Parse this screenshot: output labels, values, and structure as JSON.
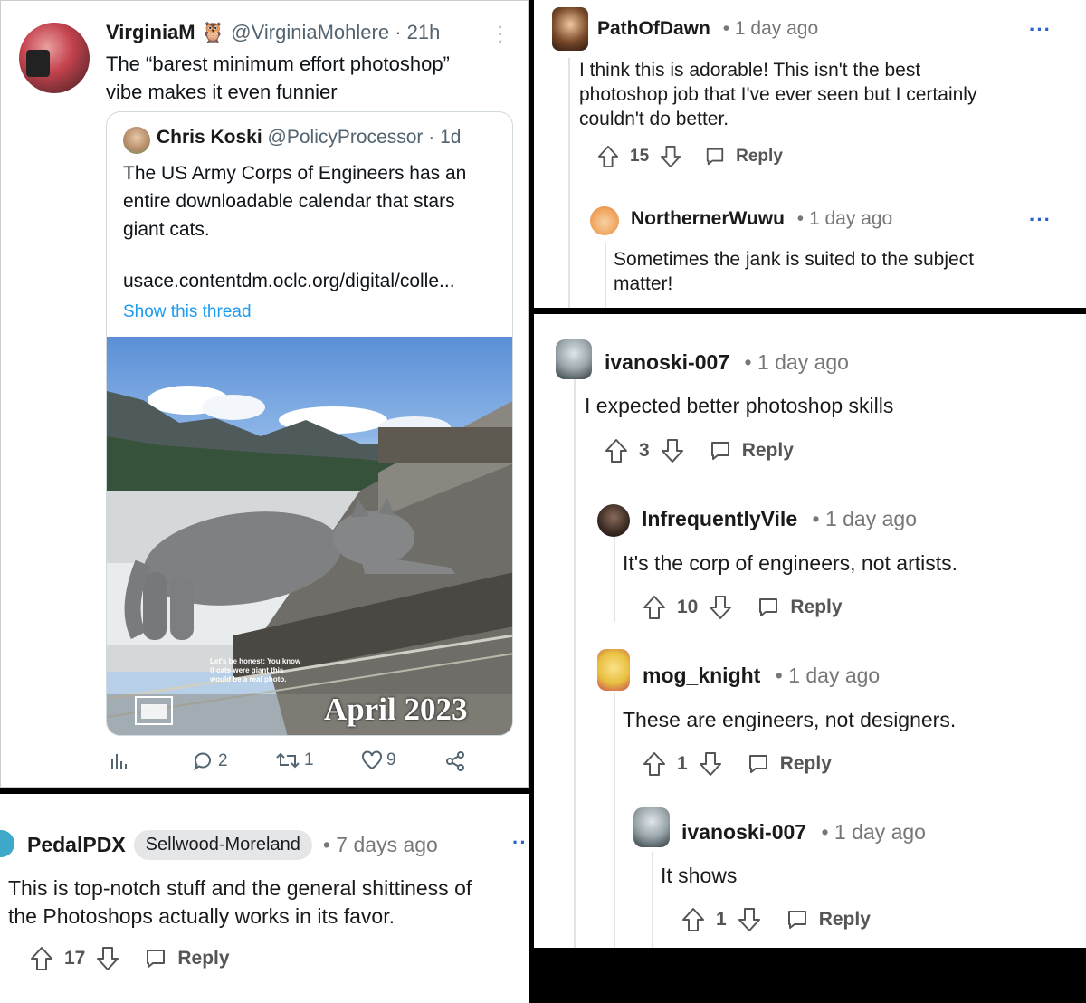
{
  "tweet": {
    "author_name": "VirginiaM",
    "author_emoji": "🦉",
    "author_handle": "@VirginiaMohlere",
    "time": "· 21h",
    "text_line1": "The “barest minimum effort photoshop”",
    "text_line2": "vibe makes it even funnier",
    "quote": {
      "author_name": "Chris Koski",
      "author_handle": "@PolicyProcessor",
      "time": "· 1d",
      "text_line1": "The US Army Corps of Engineers has an",
      "text_line2": "entire downloadable calendar that stars",
      "text_line3": "giant cats.",
      "link": "usace.contentdm.oclc.org/digital/colle...",
      "show_thread": "Show this thread",
      "image_caption_line1": "Let's be honest: You know",
      "image_caption_line2": "if cats were giant this",
      "image_caption_line3": "would be a real photo.",
      "image_month": "April 2023"
    },
    "actions": {
      "replies": "2",
      "retweets": "1",
      "likes": "9"
    }
  },
  "pedal_comment": {
    "username": "PedalPDX",
    "flair": "Sellwood-Moreland",
    "time": "• 7 days ago",
    "more": "···",
    "text_line1": "This is top-notch stuff and the general shittiness of",
    "text_line2": "the Photoshops actually works in its favor.",
    "votes": "17",
    "reply_label": "Reply"
  },
  "top_thread": [
    {
      "username": "PathOfDawn",
      "time": "• 1 day ago",
      "more": "···",
      "text_line1": "I think this is adorable! This isn't the best",
      "text_line2": "photoshop job that I've ever seen but I certainly",
      "text_line3": "couldn't do better.",
      "votes": "15",
      "reply_label": "Reply"
    },
    {
      "username": "NorthernerWuwu",
      "time": "• 1 day ago",
      "more": "···",
      "text_line1": "Sometimes the jank is suited to the subject",
      "text_line2": "matter!"
    }
  ],
  "bottom_thread": [
    {
      "username": "ivanoski-007",
      "time": "• 1 day ago",
      "text": "I expected better photoshop skills",
      "votes": "3",
      "reply_label": "Reply"
    },
    {
      "username": "InfrequentlyVile",
      "time": "• 1 day ago",
      "text": "It's the corp of engineers, not artists.",
      "votes": "10",
      "reply_label": "Reply"
    },
    {
      "username": "mog_knight",
      "time": "• 1 day ago",
      "text": "These are engineers, not designers.",
      "votes": "1",
      "reply_label": "Reply"
    },
    {
      "username": "ivanoski-007",
      "time": "• 1 day ago",
      "text": "It shows",
      "votes": "1",
      "reply_label": "Reply"
    }
  ],
  "colors": {
    "accent_link": "#1d9bf0",
    "reddit_more": "#2a63c8",
    "text_dark": "#1a1a1b",
    "text_muted": "#777777"
  },
  "icons": [
    "owl-emoji-icon",
    "analytics-icon",
    "reply-bubble-icon",
    "retweet-icon",
    "heart-icon",
    "share-icon",
    "upvote-icon",
    "downvote-icon",
    "comment-icon",
    "more-dots-icon"
  ]
}
